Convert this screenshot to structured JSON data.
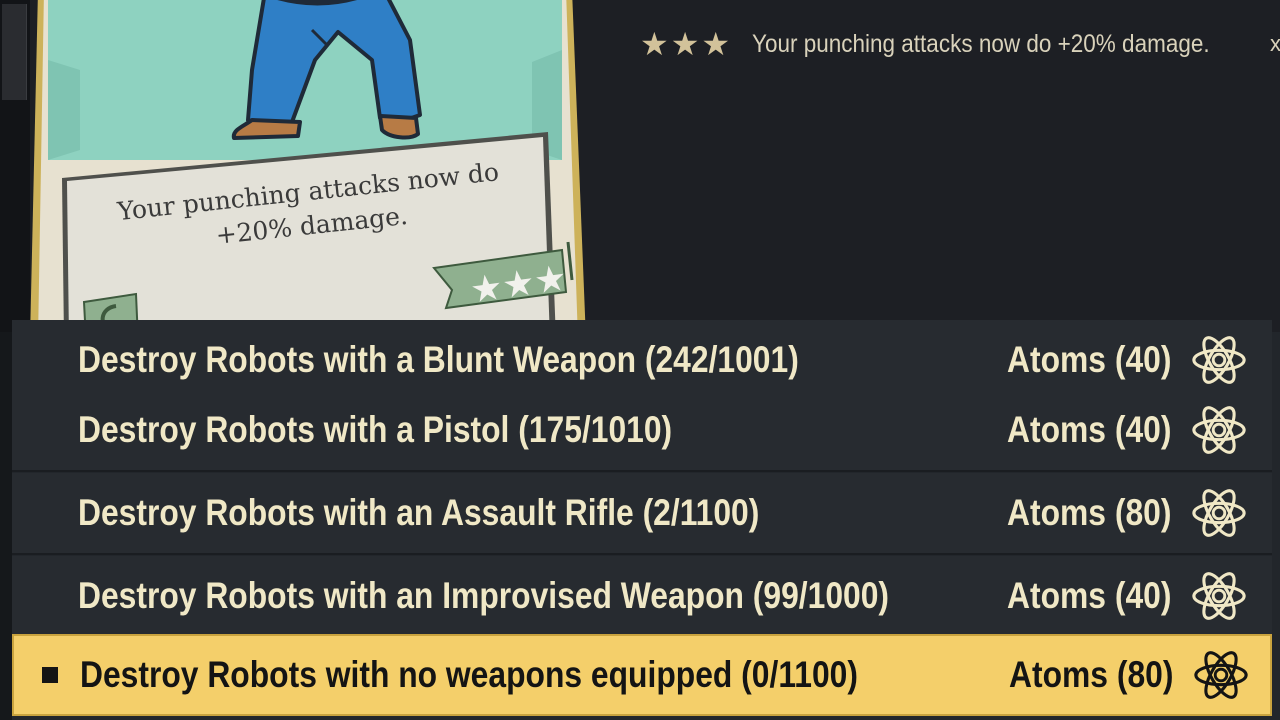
{
  "perk_card": {
    "card_text": "Your punching attacks now do +20% damage.",
    "rank_stars": 3
  },
  "perk_description": {
    "stars": "★★★",
    "text": "Your punching attacks now do +20% damage.",
    "close_glyph": "x"
  },
  "challenges": [
    {
      "label": "Destroy Robots with a Blunt Weapon (242/1001)",
      "reward": "Atoms (40)",
      "selected": false
    },
    {
      "label": "Destroy Robots with a Pistol (175/1010)",
      "reward": "Atoms (40)",
      "selected": false
    },
    {
      "label": "Destroy Robots with an Assault Rifle (2/1100)",
      "reward": "Atoms (80)",
      "selected": false
    },
    {
      "label": "Destroy Robots with an Improvised Weapon (99/1000)",
      "reward": "Atoms (40)",
      "selected": false
    },
    {
      "label": "Destroy Robots with no weapons equipped (0/1100)",
      "reward": "Atoms (80)",
      "selected": true
    }
  ],
  "icons": {
    "reward_icon": "atom-icon",
    "selection_marker": "bullet-square-icon"
  },
  "colors": {
    "selected_row": "#f4cf6a",
    "row_text": "#f0e8c6",
    "star_color": "#d2c29a",
    "card_green": "#8ed2c0"
  }
}
